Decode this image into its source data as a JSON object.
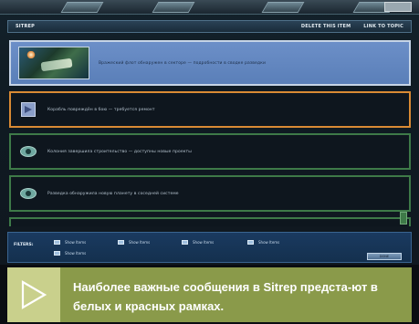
{
  "game": {
    "header": {
      "title": "SITREP",
      "buttons": [
        "DELETE THIS ITEM",
        "LINK TO TOPIC"
      ]
    },
    "messages": [
      {
        "text": "Вражеский флот обнаружен в секторе — подробности в сводке разведки",
        "border": "white",
        "thumbnail": true
      },
      {
        "text": "Корабль повреждён в бою — требуется ремонт",
        "border": "orange",
        "icon": "document-icon"
      },
      {
        "text": "Колония завершила строительство — доступны новые проекты",
        "border": "green",
        "icon": "eye-icon"
      },
      {
        "text": "Разведка обнаружила новую планету в соседней системе",
        "border": "green",
        "icon": "eye-icon"
      },
      {
        "text": "",
        "border": "green",
        "icon": "eye-icon"
      }
    ],
    "filters": {
      "label": "FILTERS:",
      "options": [
        "Show Items",
        "Show Items",
        "Show Items",
        "Show Items",
        "Show Items"
      ],
      "done_label": "DONE"
    }
  },
  "caption": {
    "text": "Наиболее важные сообщения в Sitrep предста-ют в белых и красных рамках.",
    "accent_color": "#8a9a4a",
    "arrow_bg": "#c9d08c"
  },
  "colors": {
    "highlight_border": "#c6d4e6",
    "orange_border": "#d98a34",
    "green_border": "#3e7a48"
  }
}
